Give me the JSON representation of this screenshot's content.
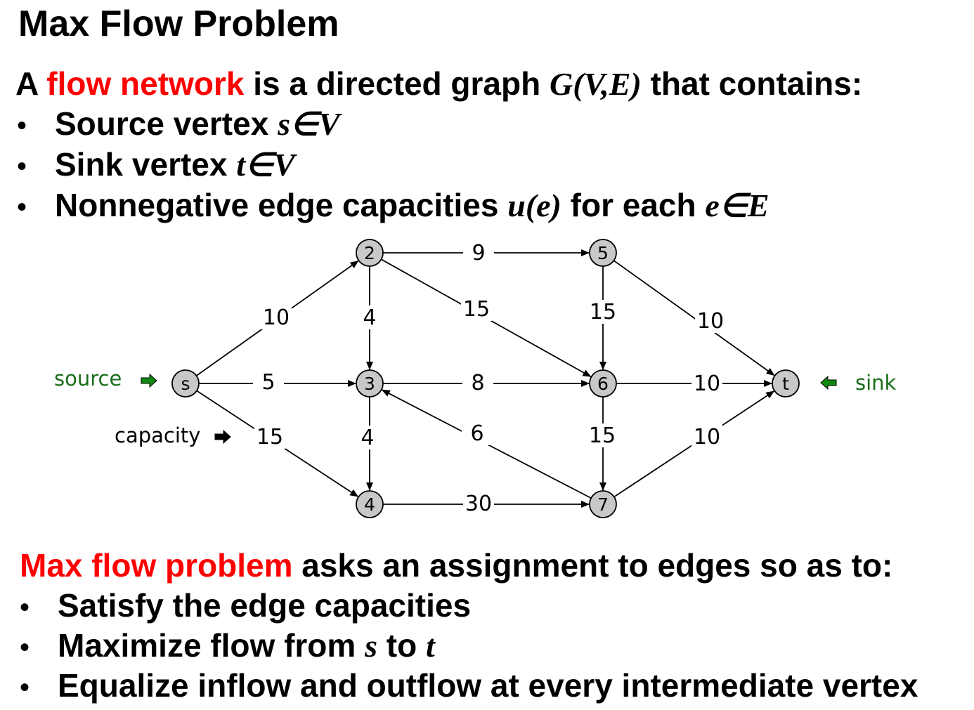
{
  "title": "Max Flow Problem",
  "definition": {
    "prefix": "A ",
    "highlight": "flow network",
    "middle": " is a directed graph ",
    "math": "G(V,E)",
    "suffix": " that contains:"
  },
  "definition_items": [
    {
      "text": "Source vertex ",
      "math": "s∈V"
    },
    {
      "text": "Sink vertex ",
      "math": "t∈V"
    },
    {
      "text": "Nonnegative edge capacities ",
      "math": "u(e)",
      "text2": " for each ",
      "math2": "e∈E"
    }
  ],
  "bullet_char": "•",
  "problem": {
    "highlight": "Max flow problem",
    "rest": " asks an assignment to edges so as to:"
  },
  "problem_items": [
    {
      "text": "Satisfy the edge capacities"
    },
    {
      "text": "Maximize flow from ",
      "math": "s",
      "text2": " to ",
      "math2": "t"
    },
    {
      "text": "Equalize inflow and outflow at every intermediate vertex"
    }
  ],
  "graph": {
    "nodes": [
      {
        "id": "s",
        "label": "s"
      },
      {
        "id": "2",
        "label": "2"
      },
      {
        "id": "3",
        "label": "3"
      },
      {
        "id": "4",
        "label": "4"
      },
      {
        "id": "5",
        "label": "5"
      },
      {
        "id": "6",
        "label": "6"
      },
      {
        "id": "7",
        "label": "7"
      },
      {
        "id": "t",
        "label": "t"
      }
    ],
    "edges": [
      {
        "from": "s",
        "to": "2",
        "capacity": "10"
      },
      {
        "from": "s",
        "to": "3",
        "capacity": "5"
      },
      {
        "from": "s",
        "to": "4",
        "capacity": "15"
      },
      {
        "from": "2",
        "to": "5",
        "capacity": "9"
      },
      {
        "from": "2",
        "to": "3",
        "capacity": "4"
      },
      {
        "from": "2",
        "to": "6",
        "capacity": "15"
      },
      {
        "from": "3",
        "to": "4",
        "capacity": "4"
      },
      {
        "from": "3",
        "to": "6",
        "capacity": "8"
      },
      {
        "from": "4",
        "to": "7",
        "capacity": "30"
      },
      {
        "from": "5",
        "to": "6",
        "capacity": "15"
      },
      {
        "from": "5",
        "to": "t",
        "capacity": "10"
      },
      {
        "from": "6",
        "to": "7",
        "capacity": "15"
      },
      {
        "from": "6",
        "to": "t",
        "capacity": "10"
      },
      {
        "from": "7",
        "to": "3",
        "capacity": "6"
      },
      {
        "from": "7",
        "to": "t",
        "capacity": "10"
      }
    ],
    "annotations": {
      "source": "source",
      "sink": "sink",
      "capacity": "capacity"
    },
    "colors": {
      "node_fill": "#c8c8c8",
      "annotation_green": "#1a6e1a",
      "arrow_green": "#118811"
    }
  }
}
